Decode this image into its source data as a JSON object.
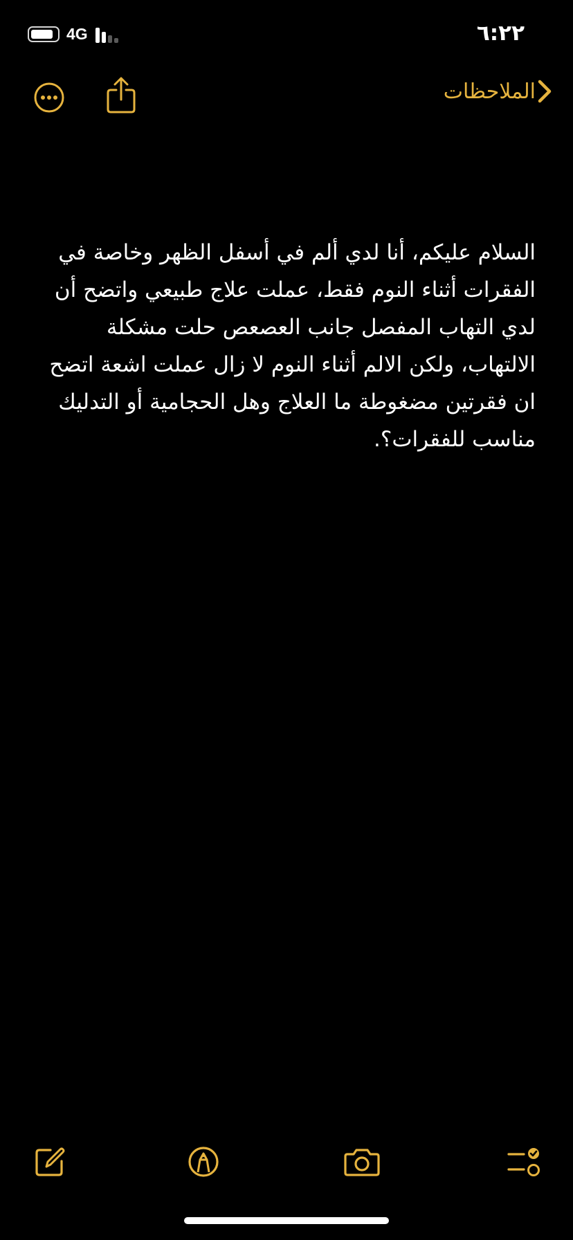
{
  "status_bar": {
    "time": "٦:٢٢",
    "network": "4G",
    "battery_level_percent": 85,
    "signal_bars_active": 2
  },
  "nav": {
    "back_label": "الملاحظات"
  },
  "note": {
    "body": "السلام عليكم، أنا لدي ألم في أسفل الظهر وخاصة في الفقرات أثناء النوم فقط، عملت علاج طبيعي واتضح أن لدي التهاب المفصل جانب العصعص حلت مشكلة الالتهاب، ولكن الالم أثناء النوم لا زال عملت اشعة اتضح ان فقرتين مضغوطة ما العلاج وهل الحجامية أو التدليك مناسب للفقرات؟."
  },
  "toolbar": {
    "icons": [
      "checklist-icon",
      "camera-icon",
      "markup-icon",
      "compose-icon"
    ]
  },
  "colors": {
    "accent": "#e6b33e",
    "background": "#000000",
    "text": "#ffffff"
  }
}
